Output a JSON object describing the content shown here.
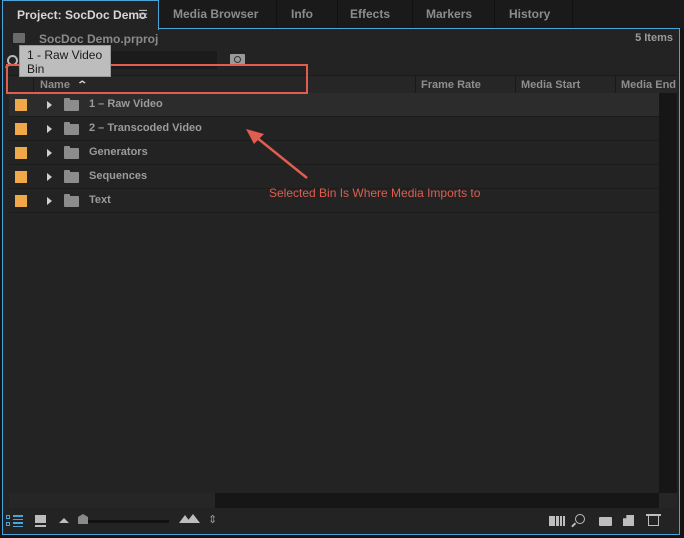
{
  "tabs": [
    {
      "label": "Project: SocDoc Demo",
      "active": true,
      "menu_icon": "hamburger-menu-icon"
    },
    {
      "label": "Media Browser"
    },
    {
      "label": "Info"
    },
    {
      "label": "Effects"
    },
    {
      "label": "Markers"
    },
    {
      "label": "History"
    }
  ],
  "project": {
    "file_name": "SocDoc Demo.prproj",
    "item_count": "5 Items",
    "search_value": "",
    "search_placeholder": ""
  },
  "tooltip": {
    "line1": "1 - Raw Video",
    "line2": "Bin"
  },
  "columns": {
    "name": "Name",
    "sort_glyph": "^",
    "frame_rate": "Frame Rate",
    "media_start": "Media Start",
    "media_end": "Media End"
  },
  "items": [
    {
      "name": "1 – Raw Video",
      "type": "bin",
      "label_color": "#f0a848",
      "selected": true
    },
    {
      "name": "2 – Transcoded Video",
      "type": "bin",
      "label_color": "#f0a848"
    },
    {
      "name": "Generators",
      "type": "bin",
      "label_color": "#f0a848"
    },
    {
      "name": "Sequences",
      "type": "bin",
      "label_color": "#f0a848"
    },
    {
      "name": "Text",
      "type": "bin",
      "label_color": "#f0a848"
    }
  ],
  "annotation": {
    "text": "Selected Bin Is Where Media Imports to",
    "color": "#e05d4f"
  },
  "bottombar": {
    "zoom_level": 0.0,
    "icons": [
      "list-view-icon",
      "icon-view-icon",
      "zoom-small-icon",
      "zoom-large-icon",
      "sort-icons-icon",
      "automate-to-sequence-icon",
      "find-icon",
      "new-bin-icon",
      "new-item-icon",
      "clear-trash-icon"
    ]
  },
  "colors": {
    "accent": "#4aa3d9",
    "bin_label": "#f0a848",
    "annotation": "#e05d4f"
  }
}
